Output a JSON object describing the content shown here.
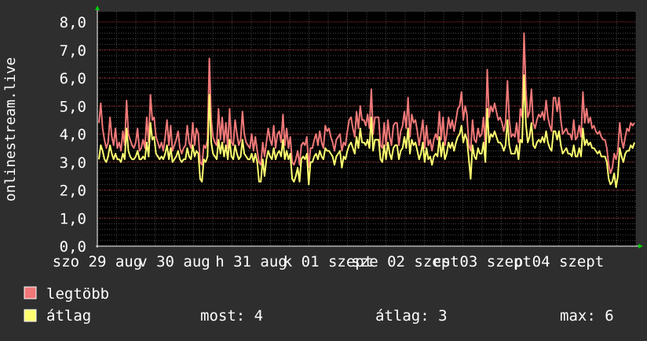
{
  "colors": {
    "background": "#2e2e2e",
    "plot_background": "#000000",
    "grid_major": "#9b2d2d",
    "grid_minor": "#4a4a4a",
    "axis": "#ffffff",
    "arrow": "#00cc00",
    "max_series": "#f07878",
    "avg_series": "#ffff70",
    "text": "#ffffff"
  },
  "chart_data": {
    "type": "line",
    "ylabel": "onlinestream.live",
    "ylim": [
      0,
      8
    ],
    "grid": true,
    "y_ticks": [
      "0,0",
      "1,0",
      "2,0",
      "3,0",
      "4,0",
      "5,0",
      "6,0",
      "7,0",
      "8,0"
    ],
    "x_ticks": [
      "szo 29 aug",
      "v 30 aug",
      "h 31 aug",
      "k 01 szept",
      "sze 02 szept",
      "cs 03 szept",
      "p 04 szept"
    ],
    "series": [
      {
        "name": "legtöbb",
        "color": "#f07878",
        "values": [
          4.4,
          5.1,
          4.2,
          3.8,
          3.5,
          3.7,
          4.6,
          3.9,
          3.6,
          4.2,
          3.5,
          3.7,
          3.4,
          4.1,
          3.6,
          5.2,
          4.0,
          3.8,
          3.6,
          3.5,
          3.7,
          4.2,
          3.4,
          3.5,
          3.8,
          3.5,
          4.6,
          3.7,
          5.4,
          4.5,
          4.6,
          3.9,
          3.7,
          3.5,
          3.7,
          3.4,
          3.9,
          4.5,
          3.6,
          4.3,
          3.4,
          3.6,
          3.8,
          4.1,
          3.5,
          3.3,
          3.5,
          3.6,
          4.3,
          3.7,
          3.5,
          4.4,
          3.6,
          4.2,
          4.0,
          3.0,
          2.9,
          3.6,
          3.5,
          3.8,
          6.7,
          4.5,
          3.9,
          3.7,
          3.6,
          4.9,
          3.8,
          4.6,
          3.7,
          4.4,
          3.5,
          4.9,
          3.7,
          3.6,
          4.5,
          4.0,
          3.6,
          3.8,
          4.8,
          4.0,
          3.7,
          3.6,
          3.5,
          4.0,
          3.4,
          3.9,
          3.4,
          3.0,
          2.9,
          3.7,
          3.2,
          3.7,
          4.2,
          3.8,
          3.6,
          4.3,
          3.5,
          4.0,
          4.1,
          3.7,
          4.7,
          3.6,
          4.2,
          3.5,
          3.9,
          3.0,
          2.9,
          3.1,
          3.4,
          2.9,
          3.6,
          3.7,
          3.6,
          3.9,
          2.8,
          3.5,
          3.5,
          3.8,
          4.0,
          3.6,
          4.1,
          3.7,
          3.5,
          4.3,
          4.1,
          4.2,
          3.9,
          3.7,
          3.4,
          3.8,
          3.9,
          4.0,
          3.4,
          3.7,
          3.6,
          4.1,
          4.5,
          4.6,
          4.2,
          3.9,
          4.8,
          4.2,
          5.0,
          4.5,
          4.5,
          4.3,
          4.7,
          4.2,
          5.6,
          4.0,
          4.6,
          4.6,
          4.6,
          3.6,
          3.5,
          4.4,
          3.6,
          4.5,
          3.9,
          3.6,
          4.3,
          4.4,
          4.4,
          3.6,
          4.1,
          4.3,
          4.8,
          4.2,
          5.3,
          3.9,
          4.7,
          4.4,
          4.5,
          4.1,
          3.6,
          4.0,
          4.5,
          3.5,
          4.3,
          3.6,
          3.8,
          3.4,
          3.8,
          4.0,
          3.8,
          4.8,
          3.8,
          4.6,
          3.6,
          4.0,
          4.6,
          4.2,
          4.5,
          4.1,
          4.5,
          4.9,
          5.0,
          5.5,
          4.5,
          5.0,
          4.7,
          3.6,
          3.4,
          4.5,
          3.8,
          3.7,
          4.2,
          3.9,
          4.0,
          4.6,
          3.5,
          6.3,
          4.6,
          5.0,
          4.8,
          5.1,
          4.8,
          4.5,
          4.6,
          4.4,
          4.1,
          4.4,
          5.9,
          4.5,
          3.9,
          4.0,
          3.9,
          4.4,
          3.7,
          4.9,
          4.6,
          7.6,
          5.6,
          4.6,
          4.8,
          5.6,
          4.4,
          4.2,
          4.5,
          4.7,
          4.6,
          4.8,
          4.5,
          5.2,
          4.6,
          4.3,
          4.1,
          5.3,
          5.3,
          4.8,
          5.3,
          4.5,
          4.0,
          4.1,
          4.2,
          4.0,
          4.0,
          3.8,
          4.5,
          3.8,
          3.9,
          4.3,
          3.9,
          5.5,
          4.4,
          4.9,
          4.4,
          4.6,
          4.2,
          4.3,
          4.1,
          4.0,
          4.1,
          3.9,
          3.8,
          3.8,
          3.5,
          2.9,
          2.6,
          2.8,
          3.3,
          3.1,
          3.4,
          4.4,
          3.8,
          3.5,
          3.9,
          4.2,
          4.1,
          4.4,
          4.3,
          4.4
        ]
      },
      {
        "name": "átlag",
        "color": "#ffff70",
        "values": [
          3.1,
          3.6,
          3.4,
          3.1,
          3.0,
          3.2,
          3.6,
          3.3,
          3.1,
          3.3,
          3.1,
          3.1,
          3.0,
          3.3,
          3.1,
          4.2,
          3.4,
          3.2,
          3.1,
          3.1,
          3.2,
          3.4,
          3.1,
          3.1,
          3.2,
          3.1,
          3.7,
          3.2,
          4.4,
          3.8,
          3.9,
          3.3,
          3.2,
          3.1,
          3.2,
          3.1,
          3.3,
          3.6,
          3.1,
          3.5,
          3.0,
          3.1,
          3.2,
          3.4,
          3.1,
          3.0,
          3.1,
          3.1,
          3.5,
          3.2,
          3.1,
          3.6,
          3.2,
          3.4,
          3.3,
          2.4,
          2.3,
          3.1,
          3.0,
          3.2,
          5.4,
          3.7,
          3.3,
          3.2,
          3.1,
          3.8,
          3.3,
          3.7,
          3.2,
          3.6,
          3.1,
          3.8,
          3.2,
          3.1,
          3.6,
          3.3,
          3.1,
          3.2,
          3.8,
          3.3,
          3.2,
          3.1,
          3.1,
          3.3,
          3.0,
          3.3,
          3.0,
          2.3,
          2.3,
          3.1,
          2.5,
          3.1,
          3.4,
          3.2,
          3.1,
          3.5,
          3.1,
          3.3,
          3.4,
          3.2,
          3.8,
          3.1,
          3.4,
          3.1,
          3.3,
          2.4,
          2.3,
          2.5,
          2.8,
          2.3,
          3.1,
          3.2,
          3.1,
          3.3,
          2.2,
          3.0,
          3.0,
          3.2,
          3.3,
          3.1,
          3.4,
          3.2,
          3.1,
          3.5,
          3.4,
          3.4,
          3.3,
          3.2,
          2.9,
          3.2,
          3.3,
          3.4,
          2.8,
          3.2,
          3.1,
          3.4,
          3.6,
          3.7,
          3.5,
          3.3,
          3.9,
          3.5,
          4.2,
          3.7,
          3.7,
          3.6,
          3.8,
          3.5,
          4.6,
          3.4,
          3.8,
          3.8,
          3.8,
          3.1,
          3.0,
          3.6,
          3.1,
          3.7,
          3.3,
          3.1,
          3.5,
          3.6,
          3.6,
          3.1,
          3.4,
          3.5,
          3.9,
          3.5,
          4.2,
          3.3,
          3.8,
          3.6,
          3.7,
          3.4,
          3.1,
          3.3,
          3.7,
          3.0,
          3.5,
          3.1,
          3.2,
          2.9,
          3.2,
          3.3,
          3.2,
          3.9,
          3.2,
          3.7,
          3.1,
          3.3,
          3.7,
          3.5,
          3.7,
          3.4,
          3.7,
          3.9,
          4.0,
          4.3,
          3.7,
          4.0,
          3.8,
          3.1,
          2.4,
          3.6,
          3.2,
          3.1,
          3.5,
          3.3,
          3.3,
          3.7,
          3.0,
          4.9,
          3.7,
          4.0,
          3.9,
          4.1,
          3.9,
          3.7,
          3.7,
          3.6,
          3.4,
          3.6,
          4.5,
          3.6,
          3.3,
          3.3,
          3.3,
          3.6,
          3.1,
          3.8,
          3.7,
          6.1,
          4.4,
          3.7,
          3.9,
          4.4,
          3.6,
          3.5,
          3.7,
          3.8,
          3.7,
          3.9,
          3.7,
          4.1,
          3.7,
          3.5,
          3.4,
          4.1,
          4.1,
          3.8,
          4.1,
          3.6,
          3.3,
          3.4,
          3.5,
          3.3,
          3.3,
          3.2,
          3.6,
          3.2,
          3.2,
          3.5,
          3.2,
          4.2,
          3.6,
          3.8,
          3.6,
          3.7,
          3.5,
          3.5,
          3.4,
          3.3,
          3.4,
          3.2,
          3.2,
          3.2,
          3.0,
          2.4,
          2.2,
          2.3,
          2.6,
          2.1,
          2.5,
          3.5,
          3.2,
          3.0,
          3.3,
          3.4,
          3.4,
          3.6,
          3.5,
          3.7
        ]
      }
    ]
  },
  "legend": {
    "items": [
      {
        "label": "legtöbb",
        "color": "#f07878"
      },
      {
        "label": "átlag",
        "color": "#ffff70"
      }
    ],
    "stats": {
      "now": "most: 4",
      "avg": "átlag: 3",
      "max": "max: 6"
    }
  }
}
